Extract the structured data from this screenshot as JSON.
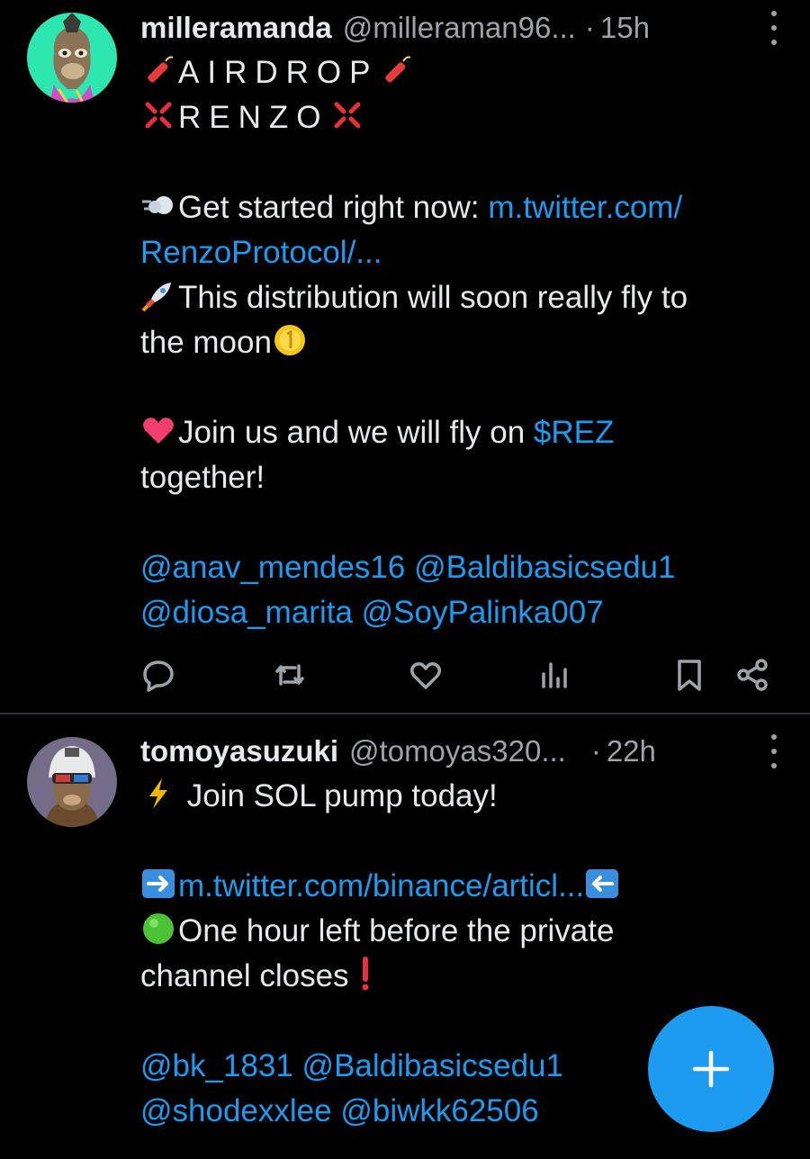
{
  "tweets": [
    {
      "author_name": "milleramanda",
      "handle": "@milleraman96...",
      "separator": "·",
      "time": "15h",
      "airdrop": "AIRDROP",
      "renzo": "RENZO",
      "get_started": "Get started right now: ",
      "link_part1": "m.twitter.com/",
      "link_part2": "RenzoProtocol/...",
      "fly_line1": "This distribution will soon really fly to",
      "fly_line2": "the moon",
      "join_pre": "Join us and we will fly on ",
      "cashtag": "$REZ",
      "join_post": "together!",
      "mentions_line1": "@anav_mendes16 @Baldibasicsedu1",
      "mentions_line2": "@diosa_marita @SoyPalinka007"
    },
    {
      "author_name": "tomoyasuzuki",
      "handle": "@tomoyas320...",
      "separator": "·",
      "time": "22h",
      "pump_line": " Join SOL pump today!",
      "link": "m.twitter.com/binance/articl...",
      "hour_line1": "One hour left before the private",
      "hour_line2": "channel closes",
      "mentions_line1": "@bk_1831 @Baldibasicsedu1",
      "mentions_line2": "@shodexxlee @biwkk62506"
    }
  ],
  "icons": [
    "reply-icon",
    "retweet-icon",
    "like-icon",
    "views-icon",
    "bookmark-icon",
    "share-icon",
    "more-icon",
    "compose-icon"
  ],
  "colors": {
    "background": "#000000",
    "text": "#e7e9ea",
    "secondary": "#9ea3a8",
    "link": "#1d9bf0",
    "divider": "#2f3336",
    "fab": "#1d9bf0"
  }
}
